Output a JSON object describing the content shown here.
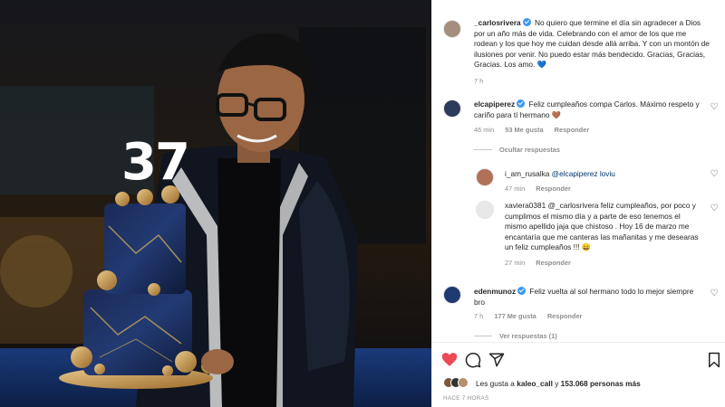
{
  "photo": {
    "cake_number": "37"
  },
  "caption": {
    "username": "_carlosrivera",
    "text": "No quiero que termine el día sin agradecer a Dios por un año más de vida. Celebrando con el amor de los que me rodean y los que hoy me cuidan desde allá arriba. Y con un montón de ilusiones por venir. No puedo estar más bendecido. Gracias, Gracias, Gracias. Los amo. 💙",
    "time": "7 h"
  },
  "comments": [
    {
      "username": "elcapiperez",
      "text": "Feliz cumpleaños compa Carlos. Máximo respeto y cariño para tí hermano 🤎",
      "time": "46 min",
      "likes": "53 Me gusta",
      "reply": "Responder",
      "toggle": "Ocultar respuestas"
    },
    {
      "username": "i_am_rusalka",
      "text": "@elcapiperez loviu",
      "time": "47 min",
      "reply": "Responder"
    },
    {
      "username": "xaviera0381",
      "text": "@_carlosrivera feliz cumpleaños, por poco y cumplimos el mismo día y a parte de eso tenemos el mismo apellido jaja que chistoso . Hoy 16 de marzo me encantaría que me canteras las mañanitas y me desearas un feliz cumpleaños !!! 😄",
      "time": "27 min",
      "reply": "Responder"
    },
    {
      "username": "edenmunoz",
      "text": "Feliz vuelta al sol hermano todo lo mejor siempre bro",
      "time": "7 h",
      "likes": "177 Me gusta",
      "reply": "Responder",
      "toggle": "Ver respuestas (1)"
    }
  ],
  "footer": {
    "likes_prefix": "Les gusta a",
    "likes_user": "kaleo_call",
    "likes_middle": "y",
    "likes_count": "153.068 personas más",
    "time": "HACE 7 HORAS"
  },
  "colors": {
    "heart": "#ed4956",
    "verified": "#3897f0",
    "muted": "#8e8e8e",
    "jacket": "#10151f"
  },
  "icons": [
    "heart-icon",
    "comment-icon",
    "share-icon",
    "bookmark-icon",
    "verified-icon"
  ]
}
